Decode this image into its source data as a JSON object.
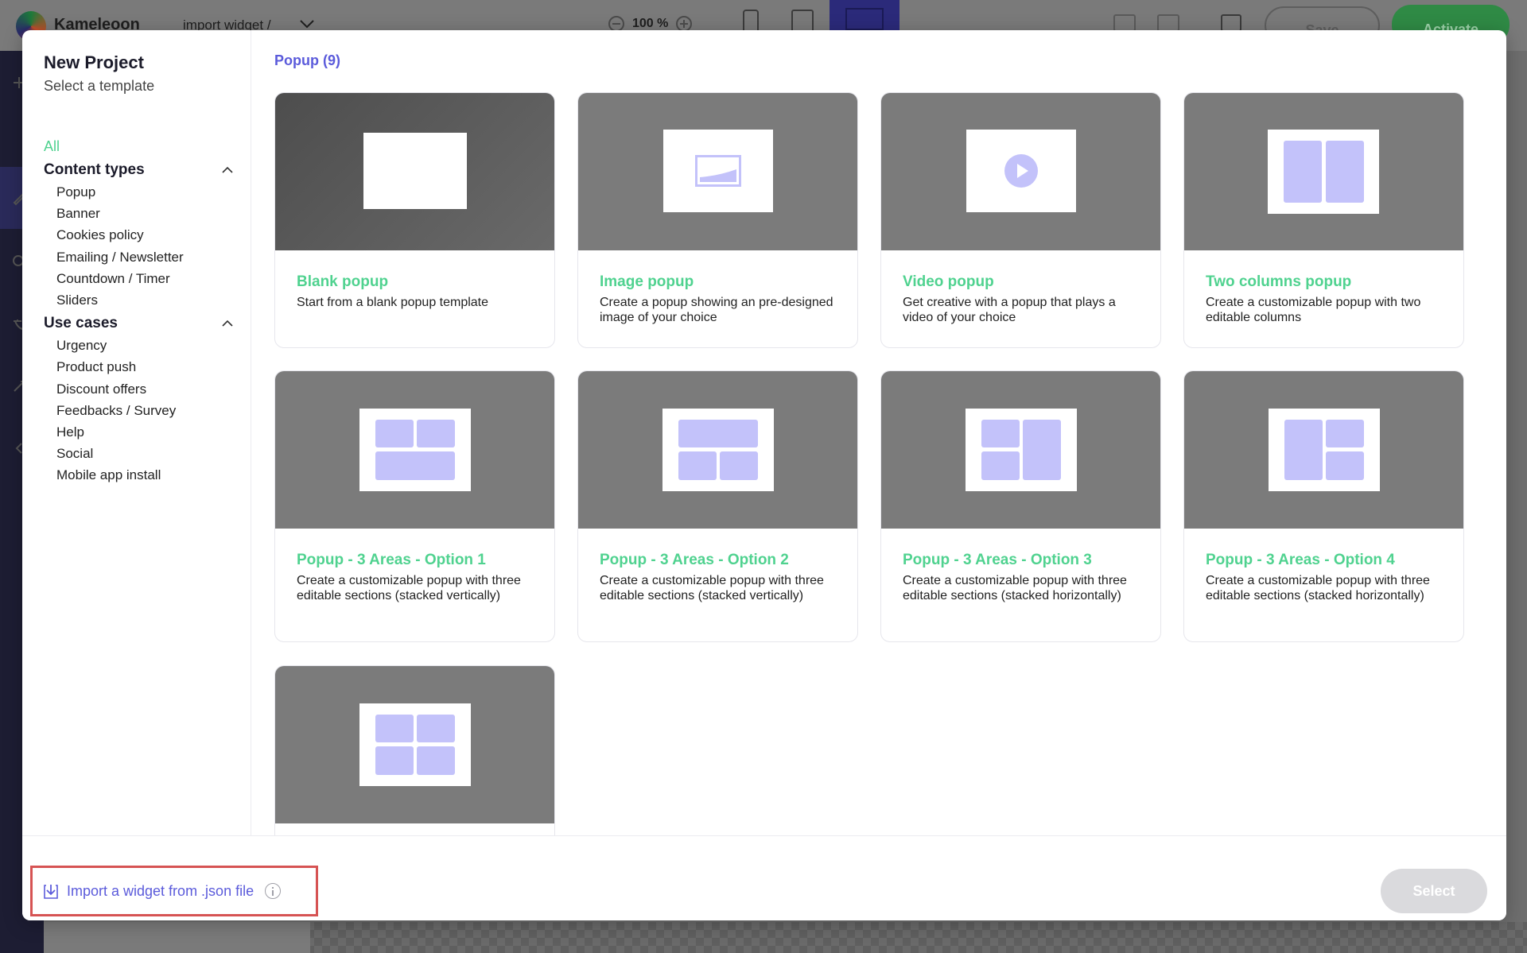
{
  "app": {
    "brand": "Kameleoon",
    "breadcrumb": "import widget /",
    "zoom": "100 %",
    "save_label": "Save",
    "activate_label": "Activate"
  },
  "modal": {
    "title": "New Project",
    "subtitle": "Select a template",
    "filter_all": "All",
    "content_types_label": "Content types",
    "content_types": [
      "Popup",
      "Banner",
      "Cookies policy",
      "Emailing / Newsletter",
      "Countdown / Timer",
      "Sliders"
    ],
    "use_cases_label": "Use cases",
    "use_cases": [
      "Urgency",
      "Product push",
      "Discount offers",
      "Feedbacks / Survey",
      "Help",
      "Social",
      "Mobile app install"
    ],
    "category_title": "Popup (9)",
    "templates": [
      {
        "title": "Blank popup",
        "desc": "Start from a blank popup template",
        "icon": "blank-frame-icon"
      },
      {
        "title": "Image popup",
        "desc": "Create a popup showing an pre-designed image of your choice",
        "icon": "image-icon"
      },
      {
        "title": "Video popup",
        "desc": "Get creative with a popup that plays a video of your choice",
        "icon": "play-icon"
      },
      {
        "title": "Two columns popup",
        "desc": "Create a customizable popup with two editable columns",
        "icon": "two-columns-icon"
      },
      {
        "title": "Popup - 3 Areas - Option 1",
        "desc": "Create a customizable popup with three editable sections (stacked vertically)",
        "icon": "three-areas-icon"
      },
      {
        "title": "Popup - 3 Areas - Option 2",
        "desc": "Create a customizable popup with three editable sections (stacked vertically)",
        "icon": "three-areas-icon"
      },
      {
        "title": "Popup - 3 Areas - Option 3",
        "desc": "Create a customizable popup with three editable sections (stacked horizontally)",
        "icon": "three-areas-icon"
      },
      {
        "title": "Popup - 3 Areas - Option 4",
        "desc": "Create a customizable popup with three editable sections (stacked horizontally)",
        "icon": "three-areas-icon"
      },
      {
        "icon": "four-areas-icon"
      }
    ],
    "import_label": "Import a widget from .json file",
    "select_label": "Select"
  },
  "colors": {
    "accent_green": "#4fd28f",
    "accent_purple": "#5b5bdb",
    "block_lavender": "#c3c2fa",
    "highlight_red": "#d65353"
  }
}
